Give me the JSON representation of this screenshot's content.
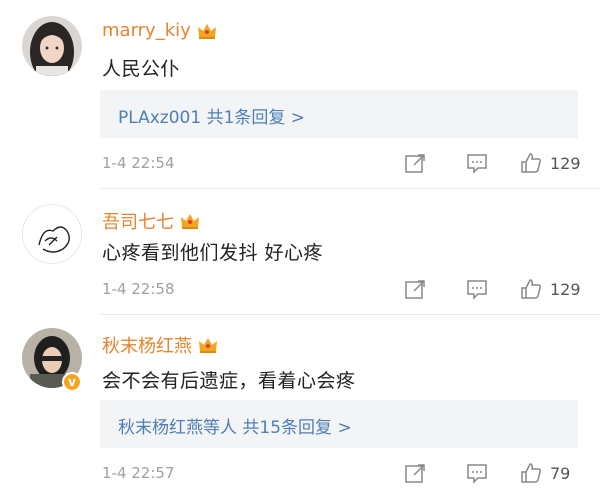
{
  "comments": [
    {
      "username": "marry_kiy",
      "text": "人民公仆",
      "reply": "PLAxz001 共1条回复 >",
      "time": "1-4 22:54",
      "likes": "129"
    },
    {
      "username": "吾司七七",
      "text": "心疼看到他们发抖  好心疼",
      "time": "1-4 22:58",
      "likes": "129"
    },
    {
      "username": "秋末杨红燕",
      "text": "会不会有后遗症，看着心会疼",
      "reply": "秋末杨红燕等人 共15条回复 >",
      "time": "1-4 22:57",
      "likes": "79",
      "verified_mark": "v"
    }
  ],
  "icons": {
    "crown": "crown-icon",
    "share": "share-icon",
    "comment": "comment-icon",
    "like": "thumbs-up-icon"
  },
  "colors": {
    "username": "#e5852d",
    "reply_link": "#4d7fb5",
    "time": "#a0a0a0",
    "reply_bg": "#f3f4f6",
    "verified_badge": "#f6a523"
  }
}
